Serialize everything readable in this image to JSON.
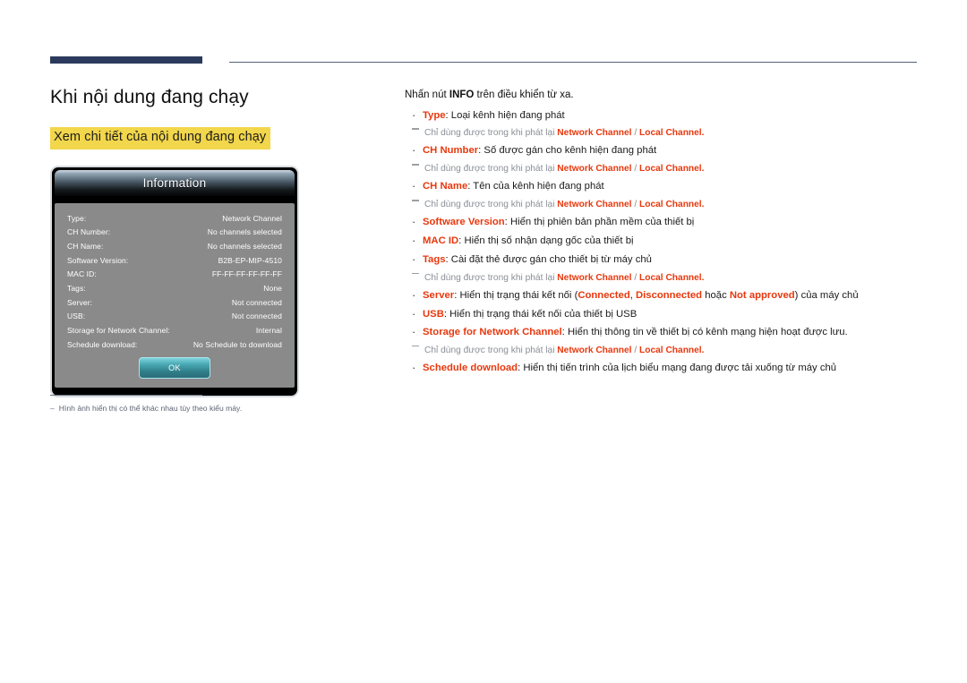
{
  "header": {
    "rule_thick_color": "#2b3a5c",
    "rule_thin_color": "#55607a"
  },
  "left": {
    "page_title": "Khi nội dung đang chạy",
    "highlight_heading": "Xem chi tiết của nội dung đang chạy",
    "highlight_color": "#f2d64b"
  },
  "dialog": {
    "title": "Information",
    "ok_label": "OK",
    "rows": [
      {
        "key": "Type:",
        "value": "Network Channel"
      },
      {
        "key": "CH Number:",
        "value": "No channels selected"
      },
      {
        "key": "CH Name:",
        "value": "No channels selected"
      },
      {
        "key": "Software Version:",
        "value": "B2B-EP-MIP-4510"
      },
      {
        "key": "MAC ID:",
        "value": "FF-FF-FF-FF-FF-FF"
      },
      {
        "key": "Tags:",
        "value": "None"
      },
      {
        "key": "Server:",
        "value": "Not connected"
      },
      {
        "key": "USB:",
        "value": "Not connected"
      },
      {
        "key": "Storage for Network Channel:",
        "value": "Internal"
      },
      {
        "key": "Schedule download:",
        "value": "No Schedule to download"
      }
    ]
  },
  "footnote": {
    "dash": "–",
    "text": "Hình ảnh hiển thị có thể khác nhau tùy theo kiểu máy."
  },
  "right": {
    "intro_before": "Nhấn nút ",
    "intro_bold": "INFO",
    "intro_after": " trên điều khiển từ xa.",
    "subnote_prefix": "Chỉ dùng được trong khi phát lại ",
    "subnote_kw1": "Network Channel",
    "subnote_sep": " / ",
    "subnote_kw2": "Local Channel",
    "subnote_suffix": ".",
    "bullets": [
      {
        "term": "Type",
        "desc": ": Loại kênh hiện đang phát",
        "subnote": true
      },
      {
        "term": "CH Number",
        "desc": ": Số được gán cho kênh hiện đang phát",
        "subnote": true
      },
      {
        "term": "CH Name",
        "desc": ": Tên của kênh hiện đang phát",
        "subnote": true
      },
      {
        "term": "Software Version",
        "desc": ": Hiển thị phiên bản phần mềm của thiết bị",
        "subnote": false
      },
      {
        "term": "MAC ID",
        "desc": ": Hiển thị số nhận dạng gốc của thiết bị",
        "subnote": false
      },
      {
        "term": "Tags",
        "desc": ": Cài đặt thẻ được gán cho thiết bị từ máy chủ",
        "subnote": true
      },
      {
        "term": "Server",
        "desc": "",
        "subnote": false,
        "special": "server"
      },
      {
        "term": "USB",
        "desc": ": Hiển thị trạng thái kết nối của thiết bị USB",
        "subnote": false
      },
      {
        "term": "Storage for Network Channel",
        "desc": ": Hiển thị thông tin về thiết bị có kênh mạng hiện hoạt được lưu.",
        "subnote": true
      },
      {
        "term": "Schedule download",
        "desc": ": Hiển thị tiến trình của lịch biểu mạng đang được tải xuống từ máy chủ",
        "subnote": false
      }
    ],
    "server_line": {
      "before": ": Hiển thị trạng thái kết nối (",
      "status1": "Connected",
      "comma": ", ",
      "status2": "Disconnected",
      "mid": " hoặc ",
      "status3": "Not approved",
      "after": ") của máy chủ"
    }
  }
}
